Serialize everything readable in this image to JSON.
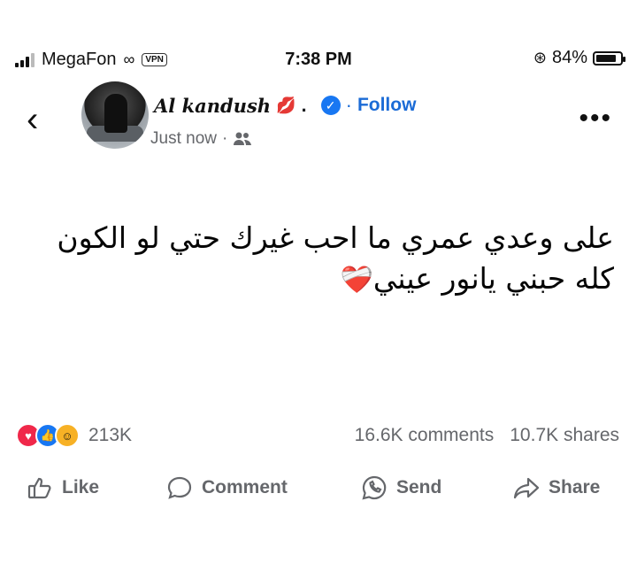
{
  "status_bar": {
    "carrier": "MegaFon",
    "vpn": "VPN",
    "time": "7:38 PM",
    "battery": "84%",
    "battery_level": 0.84
  },
  "post": {
    "author": "Al kandush",
    "author_suffix": ".",
    "separator": "·",
    "follow_label": "Follow",
    "timestamp": "Just now",
    "audience_icon": "friends-icon",
    "text": "على وعدي عمري ما احب غيرك حتي لو الكون كله حبني يانور عيني",
    "text_emoji": "❤️‍🩹"
  },
  "engagement": {
    "reactions_count": "213K",
    "comments": "16.6K comments",
    "shares": "10.7K shares"
  },
  "actions": {
    "like": "Like",
    "comment": "Comment",
    "send": "Send",
    "share": "Share"
  },
  "colors": {
    "accent": "#1877f2",
    "follow": "#1b6bd6",
    "muted": "#65676b"
  }
}
